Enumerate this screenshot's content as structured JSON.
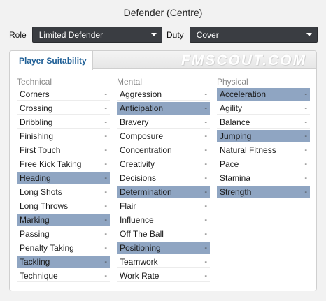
{
  "title": "Defender (Centre)",
  "role": {
    "label": "Role",
    "value": "Limited Defender"
  },
  "duty": {
    "label": "Duty",
    "value": "Cover"
  },
  "panel": {
    "tab_label": "Player Suitability",
    "watermark": "FMSCOUT.COM",
    "columns": [
      {
        "heading": "Technical",
        "items": [
          {
            "label": "Corners",
            "value": "-",
            "key": false
          },
          {
            "label": "Crossing",
            "value": "-",
            "key": false
          },
          {
            "label": "Dribbling",
            "value": "-",
            "key": false
          },
          {
            "label": "Finishing",
            "value": "-",
            "key": false
          },
          {
            "label": "First Touch",
            "value": "-",
            "key": false
          },
          {
            "label": "Free Kick Taking",
            "value": "-",
            "key": false
          },
          {
            "label": "Heading",
            "value": "-",
            "key": true
          },
          {
            "label": "Long Shots",
            "value": "-",
            "key": false
          },
          {
            "label": "Long Throws",
            "value": "-",
            "key": false
          },
          {
            "label": "Marking",
            "value": "-",
            "key": true
          },
          {
            "label": "Passing",
            "value": "-",
            "key": false
          },
          {
            "label": "Penalty Taking",
            "value": "-",
            "key": false
          },
          {
            "label": "Tackling",
            "value": "-",
            "key": true
          },
          {
            "label": "Technique",
            "value": "-",
            "key": false
          }
        ]
      },
      {
        "heading": "Mental",
        "items": [
          {
            "label": "Aggression",
            "value": "-",
            "key": false
          },
          {
            "label": "Anticipation",
            "value": "-",
            "key": true
          },
          {
            "label": "Bravery",
            "value": "-",
            "key": false
          },
          {
            "label": "Composure",
            "value": "-",
            "key": false
          },
          {
            "label": "Concentration",
            "value": "-",
            "key": false
          },
          {
            "label": "Creativity",
            "value": "-",
            "key": false
          },
          {
            "label": "Decisions",
            "value": "-",
            "key": false
          },
          {
            "label": "Determination",
            "value": "-",
            "key": true
          },
          {
            "label": "Flair",
            "value": "-",
            "key": false
          },
          {
            "label": "Influence",
            "value": "-",
            "key": false
          },
          {
            "label": "Off The Ball",
            "value": "-",
            "key": false
          },
          {
            "label": "Positioning",
            "value": "-",
            "key": true
          },
          {
            "label": "Teamwork",
            "value": "-",
            "key": false
          },
          {
            "label": "Work Rate",
            "value": "-",
            "key": false
          }
        ]
      },
      {
        "heading": "Physical",
        "items": [
          {
            "label": "Acceleration",
            "value": "-",
            "key": true
          },
          {
            "label": "Agility",
            "value": "-",
            "key": false
          },
          {
            "label": "Balance",
            "value": "-",
            "key": false
          },
          {
            "label": "Jumping",
            "value": "-",
            "key": true
          },
          {
            "label": "Natural Fitness",
            "value": "-",
            "key": false
          },
          {
            "label": "Pace",
            "value": "-",
            "key": false
          },
          {
            "label": "Stamina",
            "value": "-",
            "key": false
          },
          {
            "label": "Strength",
            "value": "-",
            "key": true
          }
        ]
      }
    ]
  },
  "colors": {
    "key_attribute_highlight": "#8fa5c2",
    "tab_text": "#1f5f96",
    "select_background": "#3a3d42"
  }
}
